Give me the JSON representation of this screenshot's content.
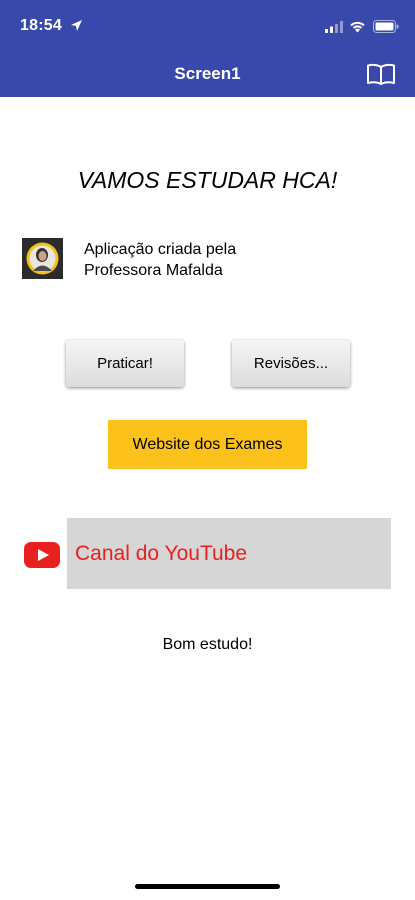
{
  "status_bar": {
    "time": "18:54",
    "location_icon": "location-arrow-icon",
    "signal_icon": "cellular-signal-icon",
    "wifi_icon": "wifi-icon",
    "battery_icon": "battery-icon"
  },
  "nav": {
    "title": "Screen1",
    "right_icon": "book-icon",
    "bar_color": "#3949ab"
  },
  "main": {
    "heading": "VAMOS ESTUDAR HCA!",
    "author": {
      "avatar_icon": "avatar-photo",
      "line1": "Aplicação criada pela",
      "line2": "Professora Mafalda"
    },
    "buttons": {
      "practice_label": "Praticar!",
      "review_label": "Revisões...",
      "exams_label": "Website dos Exames",
      "youtube_label": "Canal do YouTube"
    },
    "footer": "Bom estudo!"
  },
  "colors": {
    "accent_yellow": "#fcc21b",
    "youtube_red": "#e8201e",
    "youtube_button_bg": "#d6d6d6"
  }
}
